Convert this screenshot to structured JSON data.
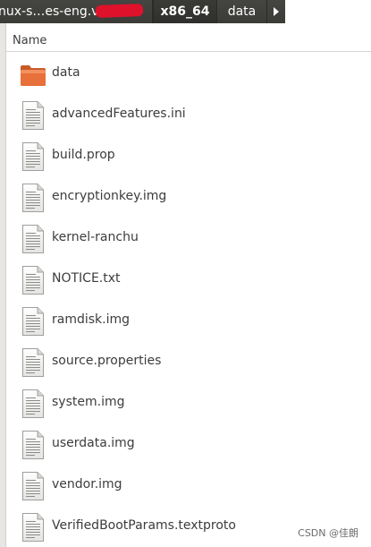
{
  "breadcrumb": {
    "parent_label": "nux-s…es-eng.v",
    "current_label": "x86_64",
    "child_label": "data"
  },
  "column_header": {
    "name_label": "Name"
  },
  "files": [
    {
      "name": "data",
      "icon": "folder-icon"
    },
    {
      "name": "advancedFeatures.ini",
      "icon": "text-file-icon"
    },
    {
      "name": "build.prop",
      "icon": "text-file-icon"
    },
    {
      "name": "encryptionkey.img",
      "icon": "text-file-icon"
    },
    {
      "name": "kernel-ranchu",
      "icon": "text-file-icon"
    },
    {
      "name": "NOTICE.txt",
      "icon": "text-file-icon"
    },
    {
      "name": "ramdisk.img",
      "icon": "text-file-icon"
    },
    {
      "name": "source.properties",
      "icon": "text-file-icon"
    },
    {
      "name": "system.img",
      "icon": "text-file-icon"
    },
    {
      "name": "userdata.img",
      "icon": "text-file-icon"
    },
    {
      "name": "vendor.img",
      "icon": "text-file-icon"
    },
    {
      "name": "VerifiedBootParams.textproto",
      "icon": "text-file-icon"
    }
  ],
  "watermark": "CSDN @佳朗",
  "colors": {
    "pathbar_bg": "#3b3b38",
    "folder_orange": "#e8703a",
    "text": "#3c3c3c"
  }
}
